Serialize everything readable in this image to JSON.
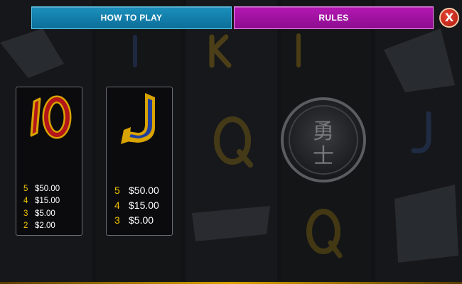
{
  "tabs": {
    "how_to_play": "HOW TO PLAY",
    "rules": "RULES"
  },
  "close_button": {
    "label": "X",
    "icon": "close-icon"
  },
  "background": {
    "description_icons": [
      "samurai-medallion-icon",
      "q-symbol-icon",
      "k-symbol-icon",
      "j-symbol-icon"
    ],
    "medallion_text": "勇士"
  },
  "paytable": [
    {
      "symbol": "10",
      "icon": "ten-symbol-icon",
      "rows": [
        {
          "count": "5",
          "value": "$50.00"
        },
        {
          "count": "4",
          "value": "$15.00"
        },
        {
          "count": "3",
          "value": "$5.00"
        },
        {
          "count": "2",
          "value": "$2.00"
        }
      ]
    },
    {
      "symbol": "J",
      "icon": "j-symbol-icon",
      "rows": [
        {
          "count": "5",
          "value": "$50.00"
        },
        {
          "count": "4",
          "value": "$15.00"
        },
        {
          "count": "3",
          "value": "$5.00"
        }
      ]
    }
  ],
  "colors": {
    "tab_how_to_play": "#1584b0",
    "tab_rules": "#a414a4",
    "close": "#c4281c",
    "pay_count": "#f2c200",
    "gold": "#d9a300"
  }
}
